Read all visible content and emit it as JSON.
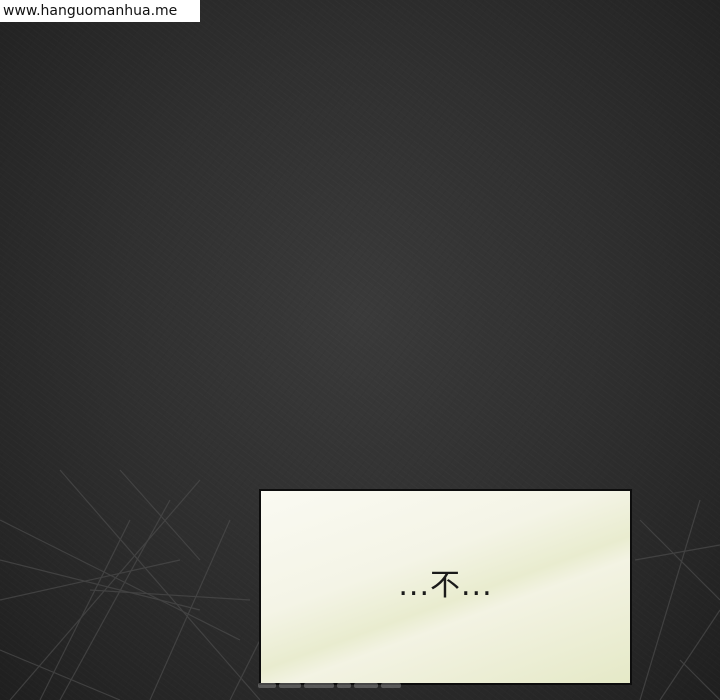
{
  "watermark": {
    "text": "www.hanguomanhua.me"
  },
  "caption": {
    "text": "...不..."
  },
  "colors": {
    "background": "#2b2b2b",
    "caption_border": "#0d0d0d",
    "caption_fill": "#f4f4e6"
  }
}
